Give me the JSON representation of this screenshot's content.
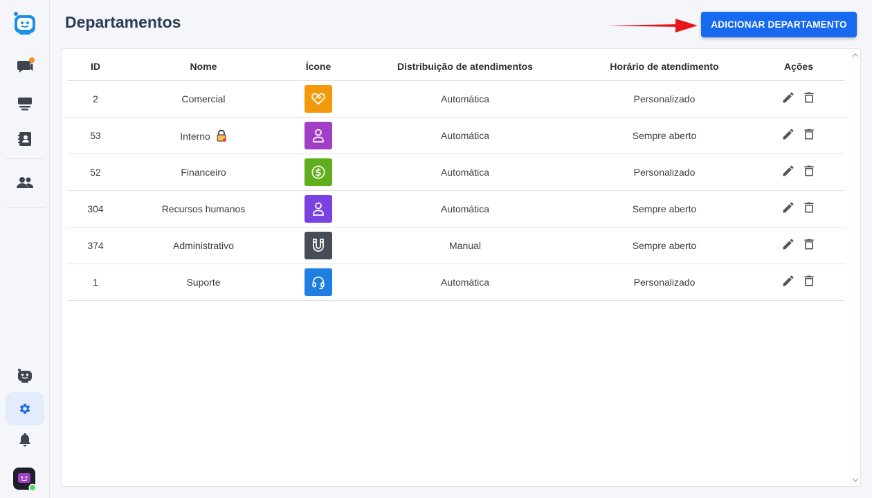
{
  "page": {
    "title": "Departamentos",
    "add_button_label": "ADICIONAR DEPARTAMENTO"
  },
  "colors": {
    "primary": "#1769f0",
    "sidebar_icon": "#3d4551",
    "sidebar_active_icon": "#1769f0",
    "notification_dot": "#f28c28",
    "arrow": "#e8141c"
  },
  "sidebar": {
    "items": [
      {
        "name": "logo",
        "icon": "bot-logo-icon"
      },
      {
        "name": "chats",
        "icon": "chat-bubbles-icon",
        "has_notification": true
      },
      {
        "name": "queues",
        "icon": "inbox-stack-icon"
      },
      {
        "name": "contacts",
        "icon": "contact-book-icon"
      },
      {
        "name": "team",
        "icon": "people-icon"
      },
      {
        "name": "bots",
        "icon": "bot-icon"
      },
      {
        "name": "settings",
        "icon": "gear-icon",
        "active": true
      },
      {
        "name": "notifications",
        "icon": "bell-icon"
      },
      {
        "name": "profile",
        "icon": "avatar-icon",
        "status": "online"
      }
    ]
  },
  "table": {
    "headers": {
      "id": "ID",
      "name": "Nome",
      "icon": "Ícone",
      "distribution": "Distribuição de atendimentos",
      "hours": "Horário de atendimento",
      "actions": "Ações"
    },
    "rows": [
      {
        "id": "2",
        "name": "Comercial",
        "icon": "handshake-heart-icon",
        "icon_color": "#f29a0b",
        "distribution": "Automática",
        "hours": "Personalizado"
      },
      {
        "id": "53",
        "name": "Interno",
        "locked": true,
        "icon": "user-icon",
        "icon_color": "#a23fc7",
        "distribution": "Automática",
        "hours": "Sempre aberto"
      },
      {
        "id": "52",
        "name": "Financeiro",
        "icon": "dollar-circle-icon",
        "icon_color": "#62ad1d",
        "distribution": "Automática",
        "hours": "Personalizado"
      },
      {
        "id": "304",
        "name": "Recursos humanos",
        "icon": "user-icon",
        "icon_color": "#7a42e0",
        "distribution": "Automática",
        "hours": "Sempre aberto"
      },
      {
        "id": "374",
        "name": "Administrativo",
        "icon": "magnet-icon",
        "icon_color": "#474d55",
        "distribution": "Manual",
        "hours": "Sempre aberto"
      },
      {
        "id": "1",
        "name": "Suporte",
        "icon": "headset-icon",
        "icon_color": "#1f7fe0",
        "distribution": "Automática",
        "hours": "Personalizado"
      }
    ]
  }
}
